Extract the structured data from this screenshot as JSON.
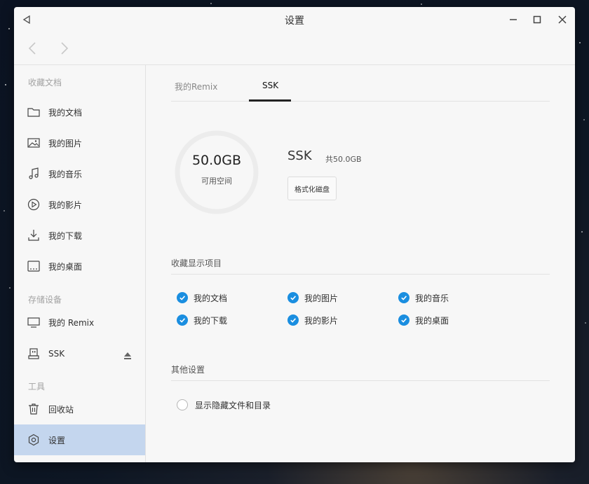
{
  "window": {
    "title": "设置"
  },
  "sidebar": {
    "favorites_title": "收藏文档",
    "favorites": [
      {
        "label": "我的文档",
        "icon": "folder-icon"
      },
      {
        "label": "我的图片",
        "icon": "image-icon"
      },
      {
        "label": "我的音乐",
        "icon": "music-icon"
      },
      {
        "label": "我的影片",
        "icon": "video-icon"
      },
      {
        "label": "我的下载",
        "icon": "download-icon"
      },
      {
        "label": "我的桌面",
        "icon": "desktop-icon"
      }
    ],
    "storage_title": "存储设备",
    "storage": [
      {
        "label": "我的 Remix",
        "icon": "monitor-icon"
      },
      {
        "label": "SSK",
        "icon": "usb-drive-icon"
      }
    ],
    "tools_title": "工具",
    "tools": [
      {
        "label": "回收站",
        "icon": "trash-icon"
      },
      {
        "label": "设置",
        "icon": "settings-icon",
        "active": true
      }
    ]
  },
  "tabs": [
    {
      "label": "我的Remix",
      "active": false
    },
    {
      "label": "SSK",
      "active": true
    }
  ],
  "device": {
    "free_space": "50.0GB",
    "free_label": "可用空间",
    "name": "SSK",
    "total": "共50.0GB",
    "format_button": "格式化磁盘",
    "used_fraction": 0.0
  },
  "display_section": {
    "title": "收藏显示项目",
    "items": [
      {
        "label": "我的文档",
        "checked": true
      },
      {
        "label": "我的图片",
        "checked": true
      },
      {
        "label": "我的音乐",
        "checked": true
      },
      {
        "label": "我的下载",
        "checked": true
      },
      {
        "label": "我的影片",
        "checked": true
      },
      {
        "label": "我的桌面",
        "checked": true
      }
    ]
  },
  "other_section": {
    "title": "其他设置",
    "show_hidden": {
      "label": "显示隐藏文件和目录",
      "checked": false
    }
  },
  "colors": {
    "accent": "#1a8ee0",
    "active_item": "#c4d6ee"
  }
}
